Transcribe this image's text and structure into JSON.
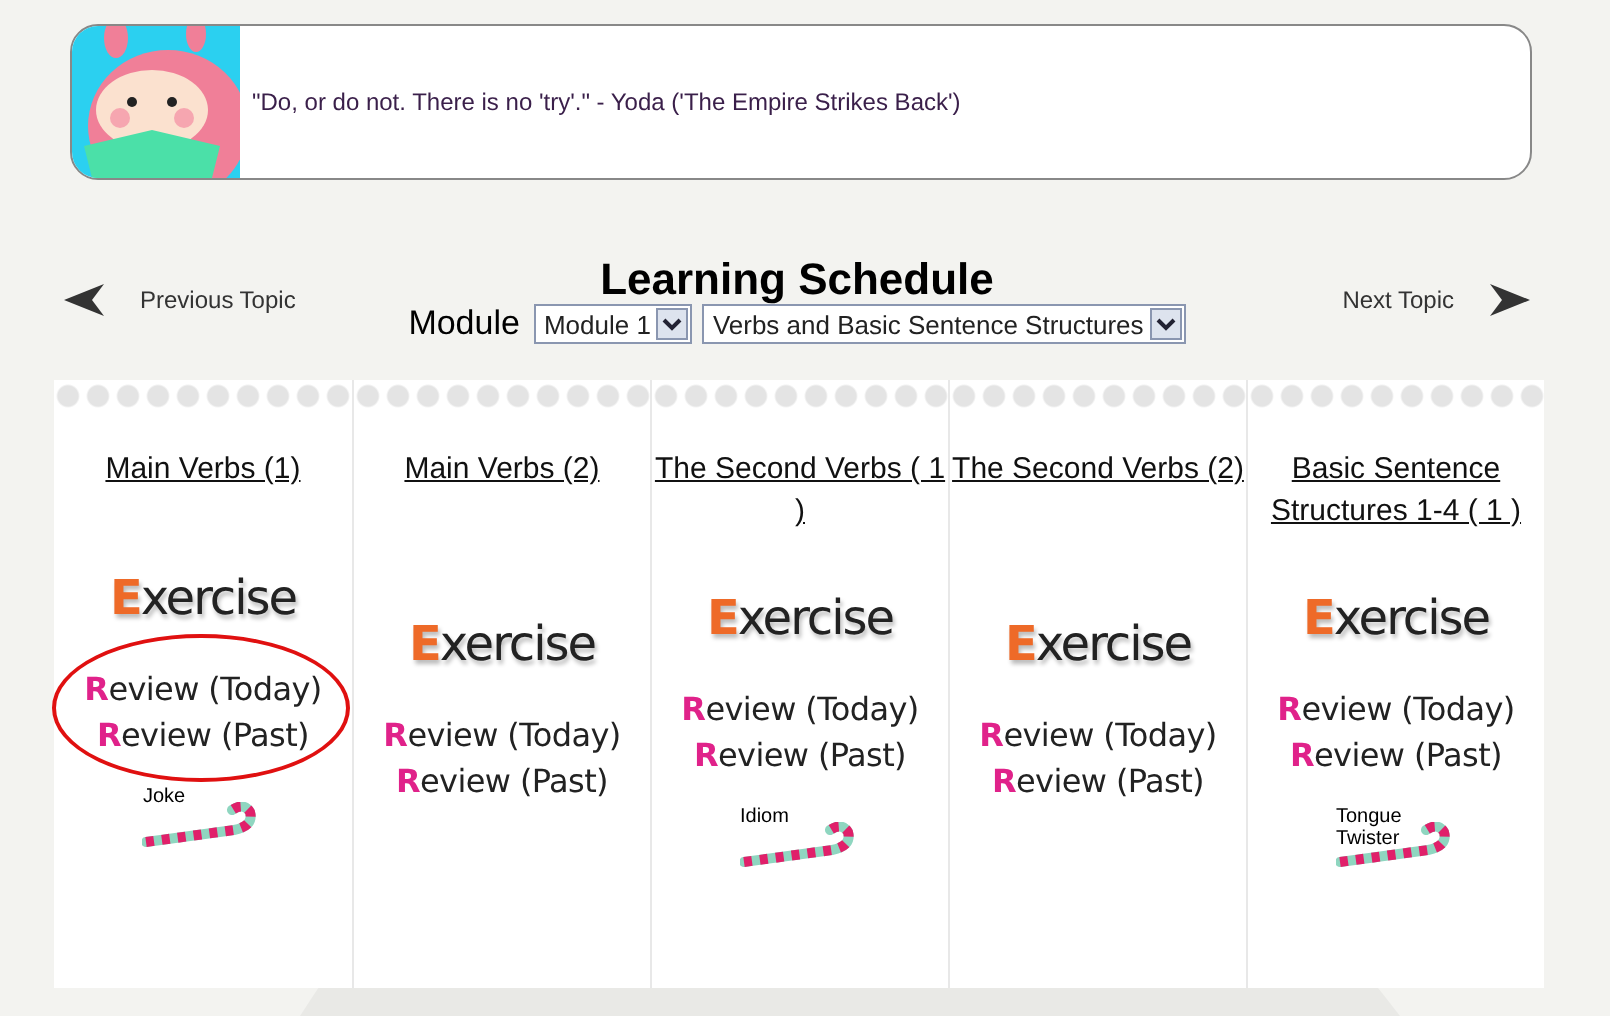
{
  "quote": {
    "text": "\"Do, or do not. There is no 'try'.\" - Yoda ('The Empire Strikes Back')"
  },
  "nav": {
    "previous": "Previous Topic",
    "next": "Next Topic"
  },
  "title": "Learning Schedule",
  "module": {
    "label": "Module",
    "module_value": "Module 1",
    "topic_value": "Verbs and Basic Sentence Structures"
  },
  "columns": [
    {
      "title": "Main Verbs (1)",
      "exercise": "Exercise",
      "review_today": "Review (Today)",
      "review_past": "Review (Past)",
      "circled": true,
      "extra": "Joke"
    },
    {
      "title": "Main Verbs (2)",
      "exercise": "Exercise",
      "review_today": "Review (Today)",
      "review_past": "Review (Past)",
      "circled": false
    },
    {
      "title": "The Second Verbs ( 1 )",
      "exercise": "Exercise",
      "review_today": "Review (Today)",
      "review_past": "Review (Past)",
      "circled": false,
      "extra": "Idiom"
    },
    {
      "title": "The Second Verbs (2)",
      "exercise": "Exercise",
      "review_today": "Review (Today)",
      "review_past": "Review (Past)",
      "circled": false
    },
    {
      "title": "Basic Sentence Structures 1-4 ( 1 )",
      "exercise": "Exercise",
      "review_today": "Review (Today)",
      "review_past": "Review (Past)",
      "circled": false,
      "extra": "Tongue Twister"
    }
  ]
}
